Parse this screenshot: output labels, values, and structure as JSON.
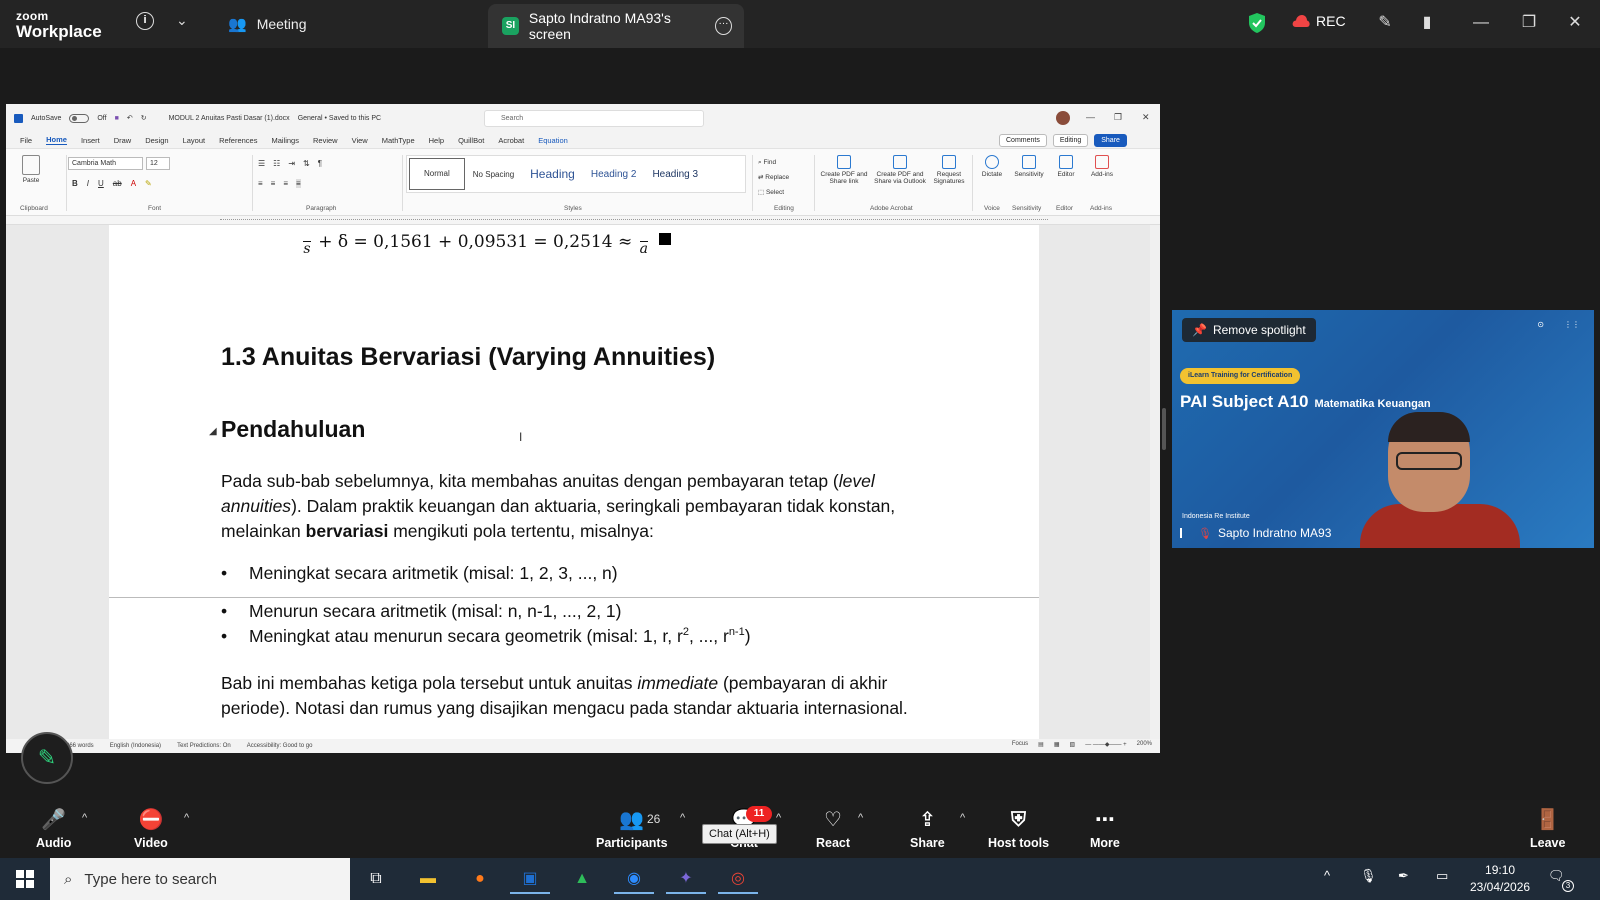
{
  "zoom": {
    "logo_line1": "zoom",
    "logo_line2": "Workplace",
    "meeting_tab": "Meeting",
    "share_tab_badge": "SI",
    "share_tab": "Sapto Indratno MA93's screen",
    "rec": "REC",
    "colors": {
      "accent_green": "#2ecf7b",
      "record_red": "#e22222"
    }
  },
  "word": {
    "autosave": "AutoSave",
    "autosave_state": "Off",
    "filename": "MODUL 2 Anuitas Pasti Dasar (1).docx",
    "saved_state": "General • Saved to this PC",
    "search_placeholder": "Search",
    "menu": [
      "File",
      "Home",
      "Insert",
      "Draw",
      "Design",
      "Layout",
      "References",
      "Mailings",
      "Review",
      "View",
      "MathType",
      "Help",
      "QuillBot",
      "Acrobat",
      "Equation"
    ],
    "menu_right": {
      "comments": "Comments",
      "editing": "Editing",
      "share": "Share"
    },
    "ribbon": {
      "paste": "Paste",
      "font_name": "Cambria Math",
      "font_size": "12",
      "styles": {
        "normal": "Normal",
        "no_spacing": "No Spacing",
        "heading": "Heading",
        "heading2": "Heading 2",
        "heading3": "Heading 3"
      },
      "find": "Find",
      "replace": "Replace",
      "select": "Select",
      "acrobat1": "Create PDF and Share link",
      "acrobat2": "Create PDF and Share via Outlook",
      "acrobat3": "Request Signatures",
      "dictate": "Dictate",
      "sensitivity": "Sensitivity",
      "editor": "Editor",
      "addins": "Add-ins",
      "groups": [
        "Clipboard",
        "Font",
        "Paragraph",
        "Styles",
        "Editing",
        "Adobe Acrobat",
        "Voice",
        "Sensitivity",
        "Editor",
        "Add-ins"
      ]
    },
    "doc": {
      "equation": "+ δ = 0,1561 + 0,09531 = 0,2514 ≈",
      "eq_frac1_den": "s",
      "eq_frac2_den": "a",
      "heading_13": "1.3 Anuitas Bervariasi (Varying Annuities)",
      "heading_pend": "Pendahuluan",
      "p1_a": "Pada sub-bab sebelumnya, kita membahas anuitas dengan pembayaran tetap (",
      "p1_b": "level annuities",
      "p1_c": "). Dalam praktik keuangan dan aktuaria, seringkali pembayaran tidak konstan, melainkan ",
      "p1_d": "bervariasi",
      "p1_e": " mengikuti pola tertentu, misalnya:",
      "bullets": [
        "Meningkat secara aritmetik (misal: 1, 2, 3, ..., n)",
        "Menurun secara aritmetik (misal: n, n-1, ..., 2, 1)",
        "Meningkat atau menurun secara geometrik (misal: 1, r, r",
        "2",
        ", ..., r",
        "n-1",
        ")"
      ],
      "p2_a": "Bab ini membahas ketiga pola tersebut untuk anuitas ",
      "p2_b": "immediate",
      "p2_c": " (pembayaran di akhir periode). Notasi dan rumus yang disajikan mengacu pada standar aktuaria internasional."
    },
    "status": {
      "words": "966 words",
      "language": "English (Indonesia)",
      "predictions": "Text Predictions: On",
      "accessibility": "Accessibility: Good to go",
      "focus": "Focus",
      "zoom": "200%"
    }
  },
  "video": {
    "remove_spotlight": "Remove spotlight",
    "tag": "iLearn Training for Certification",
    "subject": "PAI Subject A10",
    "subject_sub": "Matematika Keuangan",
    "institute": "Indonesia Re Institute",
    "name": "Sapto Indratno MA93"
  },
  "controls": {
    "audio": "Audio",
    "video": "Video",
    "participants": "Participants",
    "participants_count": "26",
    "chat": "Chat",
    "chat_badge": "11",
    "chat_tooltip": "Chat (Alt+H)",
    "react": "React",
    "share": "Share",
    "host_tools": "Host tools",
    "more": "More",
    "leave": "Leave"
  },
  "taskbar": {
    "search_placeholder": "Type here to search",
    "time": "19:10",
    "date": "23/04/2026",
    "notif_count": "3"
  }
}
